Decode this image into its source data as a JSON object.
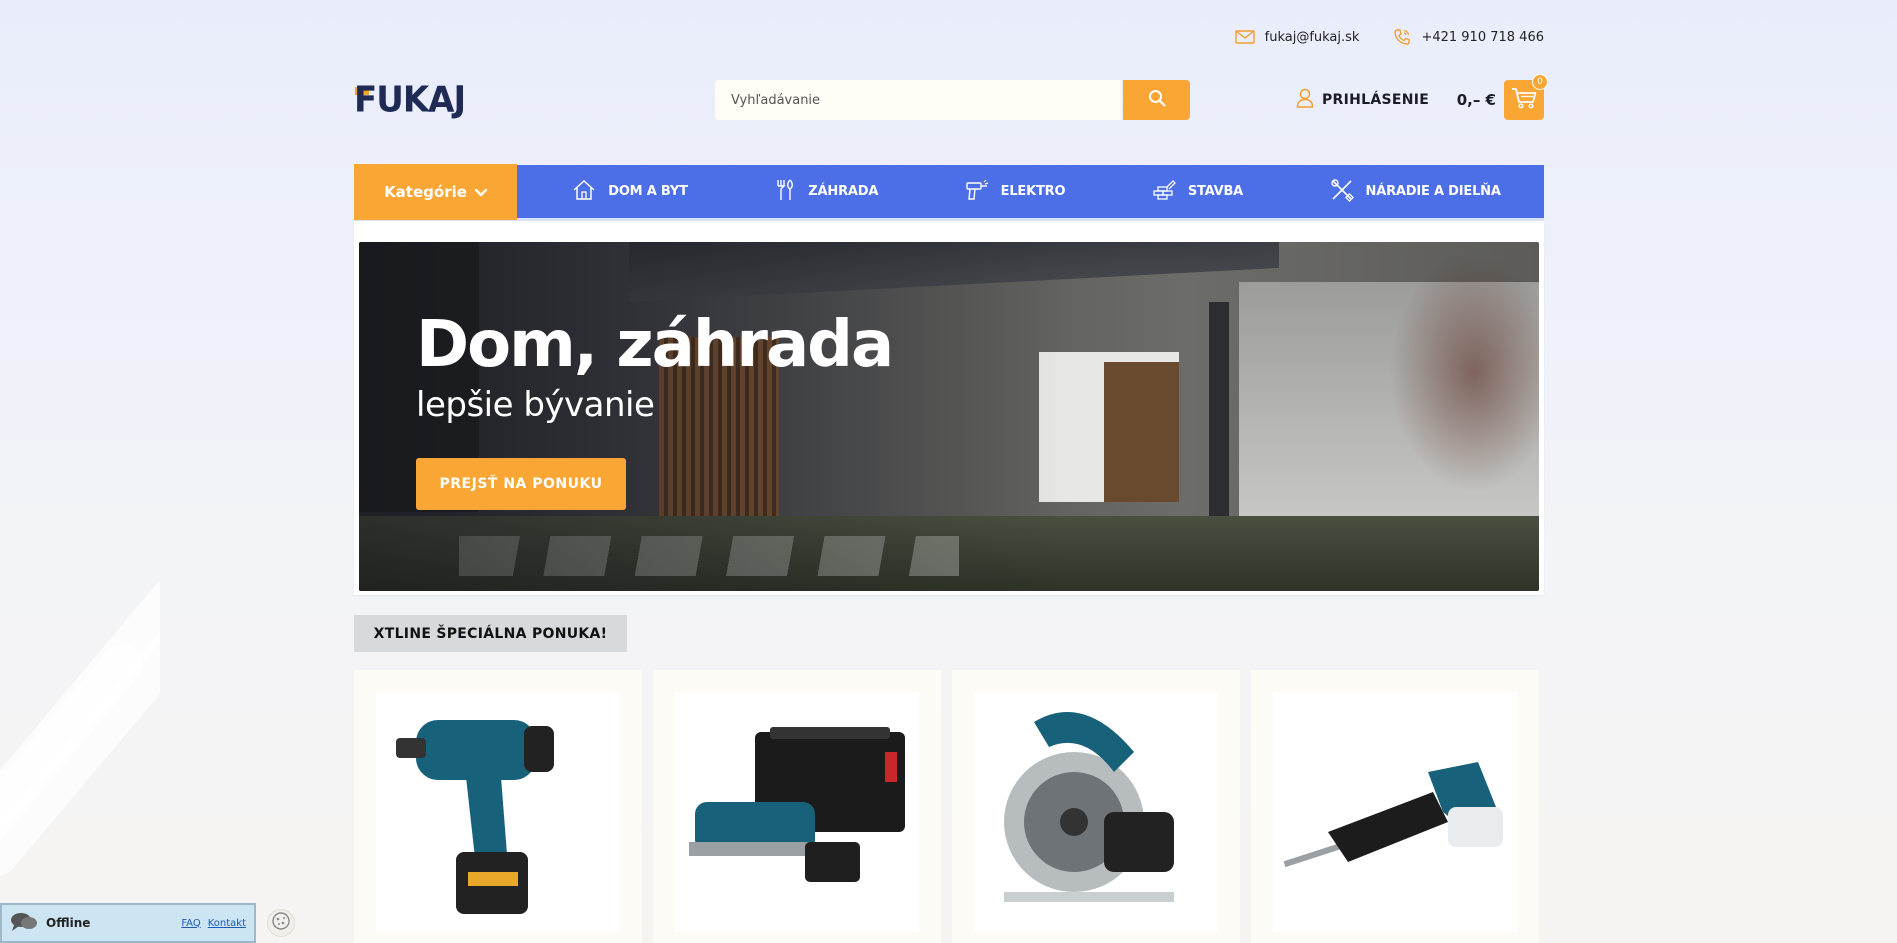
{
  "topbar": {
    "email": "fukaj@fukaj.sk",
    "phone": "+421 910 718 466"
  },
  "header": {
    "logo": "FUKAJ",
    "search_placeholder": "Vyhľadávanie",
    "login_label": "PRIHLÁSENIE",
    "cart_price": "0,– €",
    "cart_count": "0"
  },
  "nav": {
    "categories_label": "Kategórie",
    "items": [
      {
        "label": "DOM A BYT",
        "icon": "house-icon"
      },
      {
        "label": "ZÁHRADA",
        "icon": "garden-tools-icon"
      },
      {
        "label": "ELEKTRO",
        "icon": "drill-icon"
      },
      {
        "label": "STAVBA",
        "icon": "bricks-icon"
      },
      {
        "label": "NÁRADIE A DIELŇA",
        "icon": "tools-icon"
      }
    ]
  },
  "hero": {
    "title": "Dom, záhrada",
    "subtitle": "lepšie bývanie",
    "button": "PREJSŤ NA PONUKU"
  },
  "offer": {
    "title": "XTLINE ŠPECIÁLNA PONUKA!",
    "products": [
      {
        "image": "cordless-drill"
      },
      {
        "image": "planer-with-case"
      },
      {
        "image": "circular-saw"
      },
      {
        "image": "reciprocating-saw"
      }
    ]
  },
  "chat": {
    "status": "Offline",
    "faq": "FAQ",
    "contact": "Kontakt"
  },
  "colors": {
    "accent": "#f9a635",
    "nav_blue": "#4c6ee6",
    "logo_dark": "#1f2a55"
  }
}
